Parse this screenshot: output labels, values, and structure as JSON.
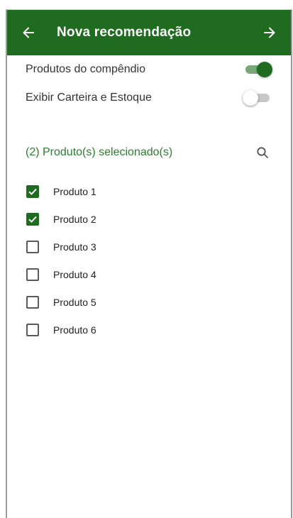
{
  "colors": {
    "primary": "#1f6b1f",
    "accent_text": "#2e7d32",
    "switch_track_on": "#78a878",
    "switch_track_off": "#c8c8c8"
  },
  "appbar": {
    "title": "Nova recomendação",
    "back_icon": "arrow-left-icon",
    "next_icon": "arrow-right-icon"
  },
  "settings": [
    {
      "label": "Produtos do compêndio",
      "on": true
    },
    {
      "label": "Exibir Carteira e Estoque",
      "on": false
    }
  ],
  "selection": {
    "summary": "(2) Produto(s) selecionado(s)",
    "search_icon": "search-icon"
  },
  "products": [
    {
      "label": "Produto 1",
      "checked": true
    },
    {
      "label": "Produto 2",
      "checked": true
    },
    {
      "label": "Produto 3",
      "checked": false
    },
    {
      "label": "Produto 4",
      "checked": false
    },
    {
      "label": "Produto 5",
      "checked": false
    },
    {
      "label": "Produto 6",
      "checked": false
    }
  ]
}
